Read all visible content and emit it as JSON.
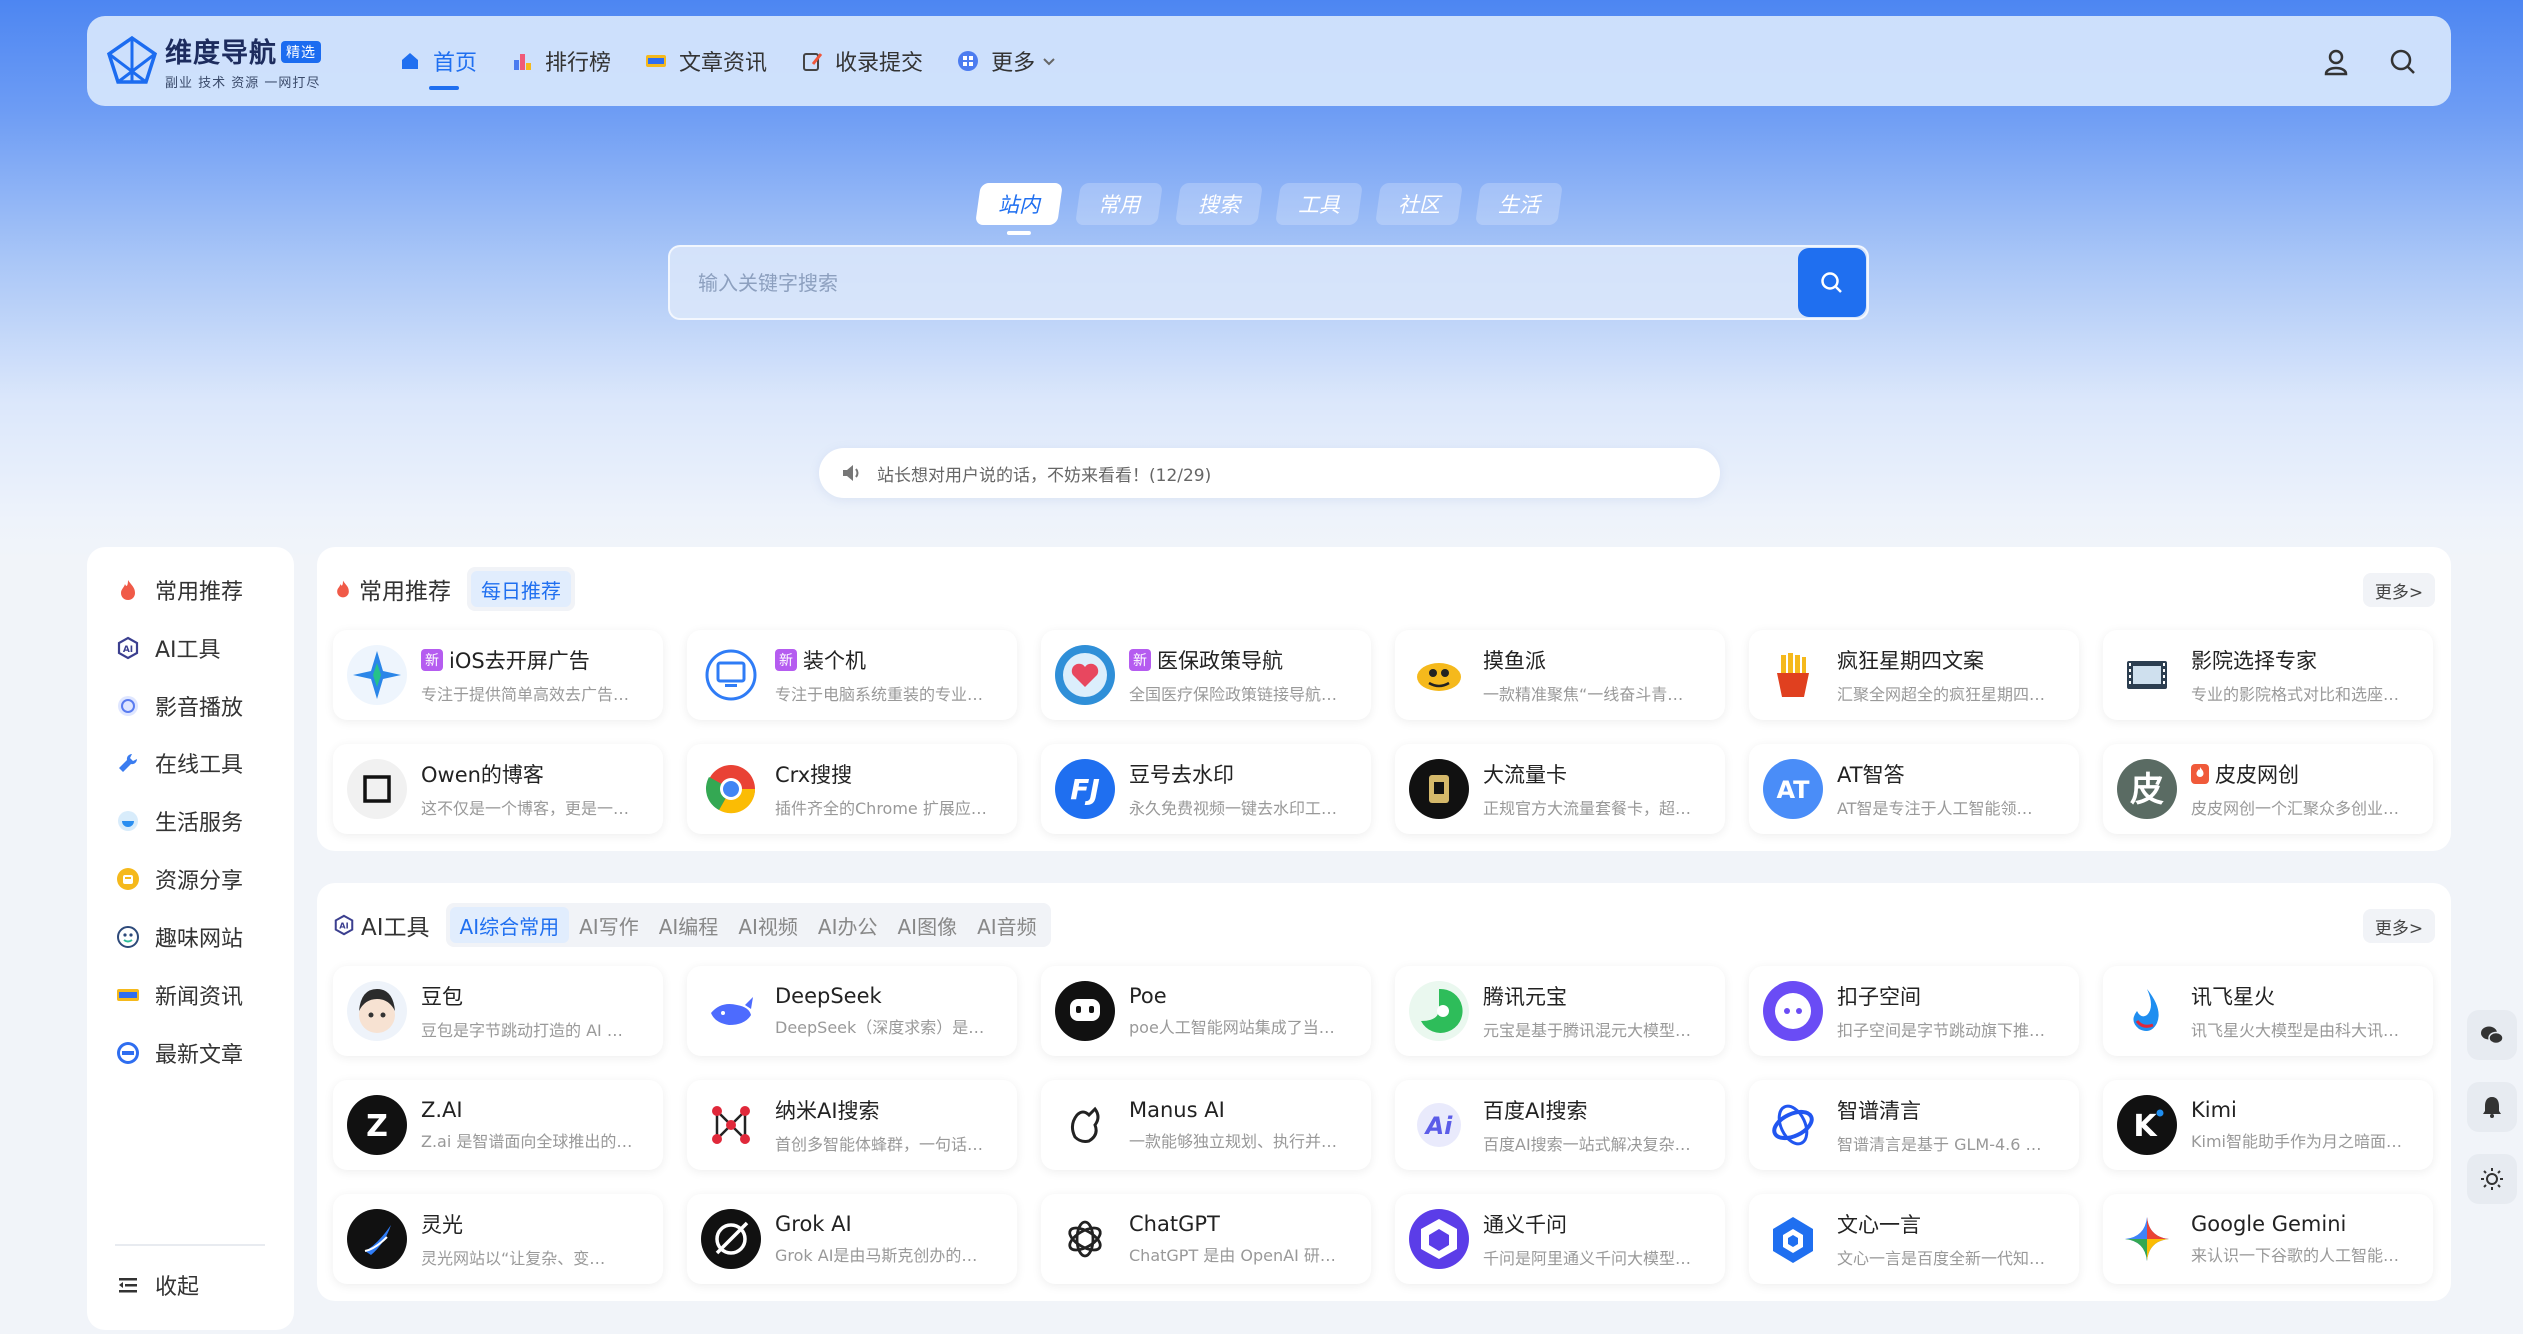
{
  "brand": {
    "name": "维度导航",
    "badge": "精选",
    "slogan": "副业 技术 资源 一网打尽"
  },
  "nav": [
    {
      "label": "首页",
      "icon": "home-icon"
    },
    {
      "label": "排行榜",
      "icon": "ranking-icon"
    },
    {
      "label": "文章资讯",
      "icon": "news-icon"
    },
    {
      "label": "收录提交",
      "icon": "submit-icon"
    },
    {
      "label": "更多",
      "icon": "more-icon"
    }
  ],
  "search": {
    "tabs": [
      "站内",
      "常用",
      "搜索",
      "工具",
      "社区",
      "生活"
    ],
    "active_tab": "站内",
    "placeholder": "输入关键字搜索"
  },
  "notice": {
    "text": "站长想对用户说的话，不妨来看看！(12/29)"
  },
  "sidebar": {
    "items": [
      {
        "label": "常用推荐",
        "icon": "fire-icon"
      },
      {
        "label": "AI工具",
        "icon": "ai-icon"
      },
      {
        "label": "影音播放",
        "icon": "play-icon"
      },
      {
        "label": "在线工具",
        "icon": "wrench-icon"
      },
      {
        "label": "生活服务",
        "icon": "life-icon"
      },
      {
        "label": "资源分享",
        "icon": "share-icon"
      },
      {
        "label": "趣味网站",
        "icon": "fun-icon"
      },
      {
        "label": "新闻资讯",
        "icon": "news-icon"
      },
      {
        "label": "最新文章",
        "icon": "new-article-icon"
      }
    ],
    "collapse_label": "收起"
  },
  "recommended": {
    "title": "常用推荐",
    "tab": "每日推荐",
    "more": "更多>",
    "cards": [
      {
        "name": "iOS去开屏广告",
        "badge": "新",
        "desc": "专注于提供简单高效去广告…",
        "icon": "star-shape",
        "color": "#2b86e8"
      },
      {
        "name": "装个机",
        "badge": "新",
        "desc": "专注于电脑系统重装的专业…",
        "icon": "monitor",
        "color": "#2f7cf6"
      },
      {
        "name": "医保政策导航",
        "badge": "新",
        "desc": "全国医疗保险政策链接导航…",
        "icon": "heart",
        "color": "#2f8fd8"
      },
      {
        "name": "摸鱼派",
        "badge": "",
        "desc": "一款精准聚焦“一线奋斗青…",
        "icon": "fish",
        "color": "#f5b91c"
      },
      {
        "name": "疯狂星期四文案",
        "badge": "",
        "desc": "汇聚全网超全的疯狂星期四…",
        "icon": "fries",
        "color": "#e0401f"
      },
      {
        "name": "影院选择专家",
        "badge": "",
        "desc": "专业的影院格式对比和选座…",
        "icon": "film",
        "color": "#2c3e50"
      },
      {
        "name": "Owen的博客",
        "badge": "",
        "desc": "这不仅是一个博客，更是一…",
        "icon": "box",
        "color": "#111111"
      },
      {
        "name": "Crx搜搜",
        "badge": "",
        "desc": "插件齐全的Chrome 扩展应…",
        "icon": "chrome",
        "color": "#e94235"
      },
      {
        "name": "豆号去水印",
        "badge": "",
        "desc": "永久免费视频一键去水印工…",
        "icon": "fj",
        "color": "#1f6ff0"
      },
      {
        "name": "大流量卡",
        "badge": "",
        "desc": "正规官方大流量套餐卡，超…",
        "icon": "sim",
        "color": "#111111"
      },
      {
        "name": "AT智答",
        "badge": "",
        "desc": "AT智是专注于人工智能领…",
        "icon": "at",
        "color": "#4a8df8"
      },
      {
        "name": "皮皮网创",
        "badge": "hot",
        "desc": "皮皮网创一个汇聚众多创业…",
        "icon": "pi",
        "color": "#5a6b63"
      }
    ]
  },
  "ai_tools": {
    "title": "AI工具",
    "tabs": [
      "AI综合常用",
      "AI写作",
      "AI编程",
      "AI视频",
      "AI办公",
      "AI图像",
      "AI音频"
    ],
    "active_tab": "AI综合常用",
    "more": "更多>",
    "cards": [
      {
        "name": "豆包",
        "desc": "豆包是字节跳动打造的 AI …",
        "icon": "doubao",
        "color": "#f3d9c6"
      },
      {
        "name": "DeepSeek",
        "desc": "DeepSeek（深度求索）是…",
        "icon": "whale",
        "color": "#4d6bfe"
      },
      {
        "name": "Poe",
        "desc": "poe人工智能网站集成了当…",
        "icon": "poe",
        "color": "#111111"
      },
      {
        "name": "腾讯元宝",
        "desc": "元宝是基于腾讯混元大模型…",
        "icon": "yuanbao",
        "color": "#2ebd5a"
      },
      {
        "name": "扣子空间",
        "desc": "扣子空间是字节跳动旗下推…",
        "icon": "coze",
        "color": "#6a4cf5"
      },
      {
        "name": "讯飞星火",
        "desc": "讯飞星火大模型是由科大讯…",
        "icon": "spark",
        "color": "#1f8ef0"
      },
      {
        "name": "Z.AI",
        "desc": "Z.ai 是智谱面向全球推出的…",
        "icon": "z",
        "color": "#111111"
      },
      {
        "name": "纳米AI搜索",
        "desc": "首创多智能体蜂群，一句话…",
        "icon": "nano",
        "color": "#e0283a"
      },
      {
        "name": "Manus AI",
        "desc": "一款能够独立规划、执行并…",
        "icon": "manus",
        "color": "#222222"
      },
      {
        "name": "百度AI搜索",
        "desc": "百度AI搜索一站式解决复杂…",
        "icon": "baidu-ai",
        "color": "#5b5ce8"
      },
      {
        "name": "智谱清言",
        "desc": "智谱清言是基于 GLM-4.6 …",
        "icon": "zhipu",
        "color": "#2156f0"
      },
      {
        "name": "Kimi",
        "desc": "Kimi智能助手作为月之暗面…",
        "icon": "kimi",
        "color": "#111111"
      },
      {
        "name": "灵光",
        "desc": "灵光网站以“让复杂、变…",
        "icon": "lingguang",
        "color": "#111111"
      },
      {
        "name": "Grok AI",
        "desc": "Grok AI是由马斯克创办的…",
        "icon": "grok",
        "color": "#111111"
      },
      {
        "name": "ChatGPT",
        "desc": "ChatGPT 是由 OpenAI 研…",
        "icon": "openai",
        "color": "#ffffff"
      },
      {
        "name": "通义千问",
        "desc": "千问是阿里通义千问大模型…",
        "icon": "qwen",
        "color": "#5b3de8"
      },
      {
        "name": "文心一言",
        "desc": "文心一言是百度全新一代知…",
        "icon": "wenxin",
        "color": "#1f6ff0"
      },
      {
        "name": "Google Gemini",
        "desc": "来认识一下谷歌的人工智能…",
        "icon": "gemini",
        "color": "#ffffff"
      }
    ]
  },
  "float_buttons": [
    "wechat-icon",
    "bell-icon",
    "theme-sun-icon"
  ]
}
